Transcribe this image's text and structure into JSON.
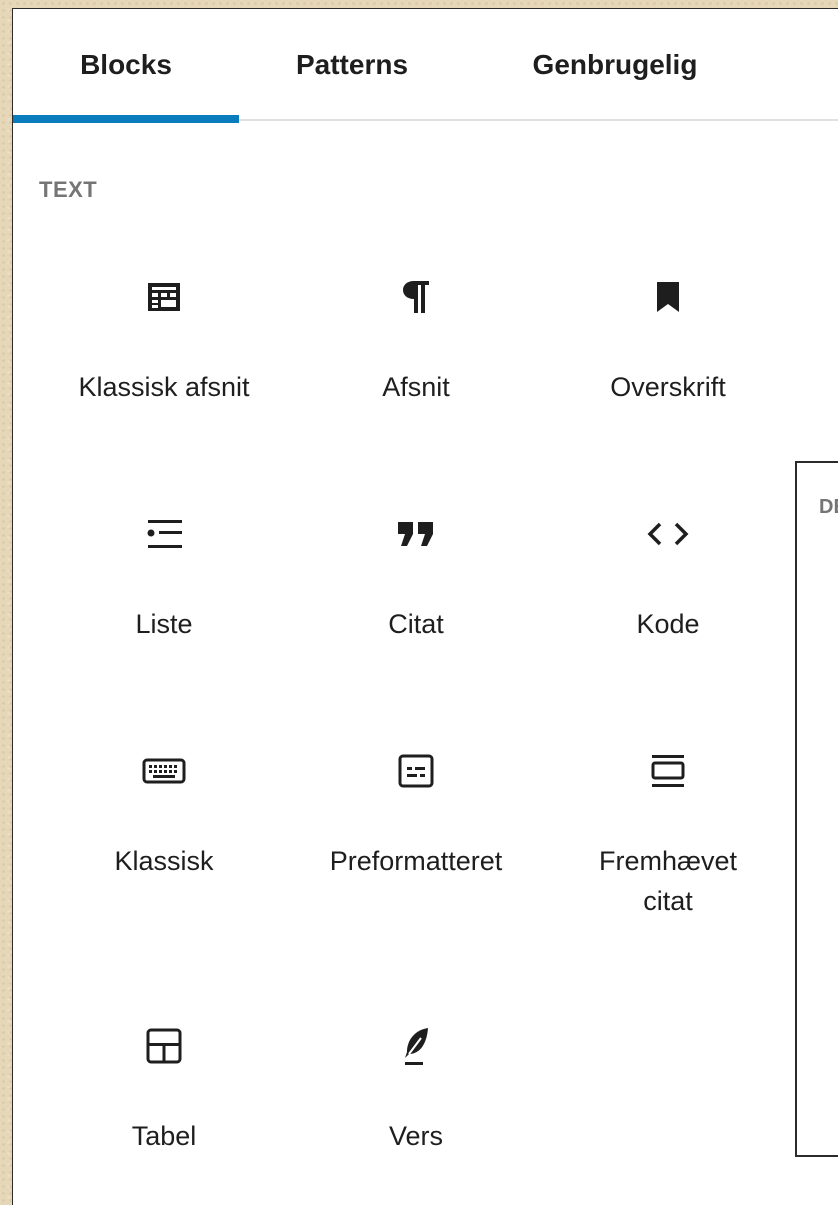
{
  "tabs": [
    {
      "label": "Blocks",
      "active": true
    },
    {
      "label": "Patterns",
      "active": false
    },
    {
      "label": "Genbrugelig",
      "active": false
    }
  ],
  "section": {
    "heading": "TEXT"
  },
  "blocks": [
    {
      "label": "Klassisk afsnit",
      "icon": "classic-paragraph-icon"
    },
    {
      "label": "Afsnit",
      "icon": "pilcrow-icon"
    },
    {
      "label": "Overskrift",
      "icon": "bookmark-icon"
    },
    {
      "label": "Liste",
      "icon": "list-icon"
    },
    {
      "label": "Citat",
      "icon": "quote-icon"
    },
    {
      "label": "Kode",
      "icon": "code-icon"
    },
    {
      "label": "Klassisk",
      "icon": "keyboard-icon"
    },
    {
      "label": "Preformatteret",
      "icon": "preformatted-icon"
    },
    {
      "label": "Fremhævet citat",
      "icon": "pullquote-icon"
    },
    {
      "label": "Tabel",
      "icon": "table-icon"
    },
    {
      "label": "Vers",
      "icon": "feather-icon"
    }
  ],
  "popover": {
    "text": "DE"
  },
  "colors": {
    "accent": "#0a7bbd",
    "text": "#1e1e1e",
    "muted": "#757575",
    "backdrop": "#e6d7b9"
  }
}
